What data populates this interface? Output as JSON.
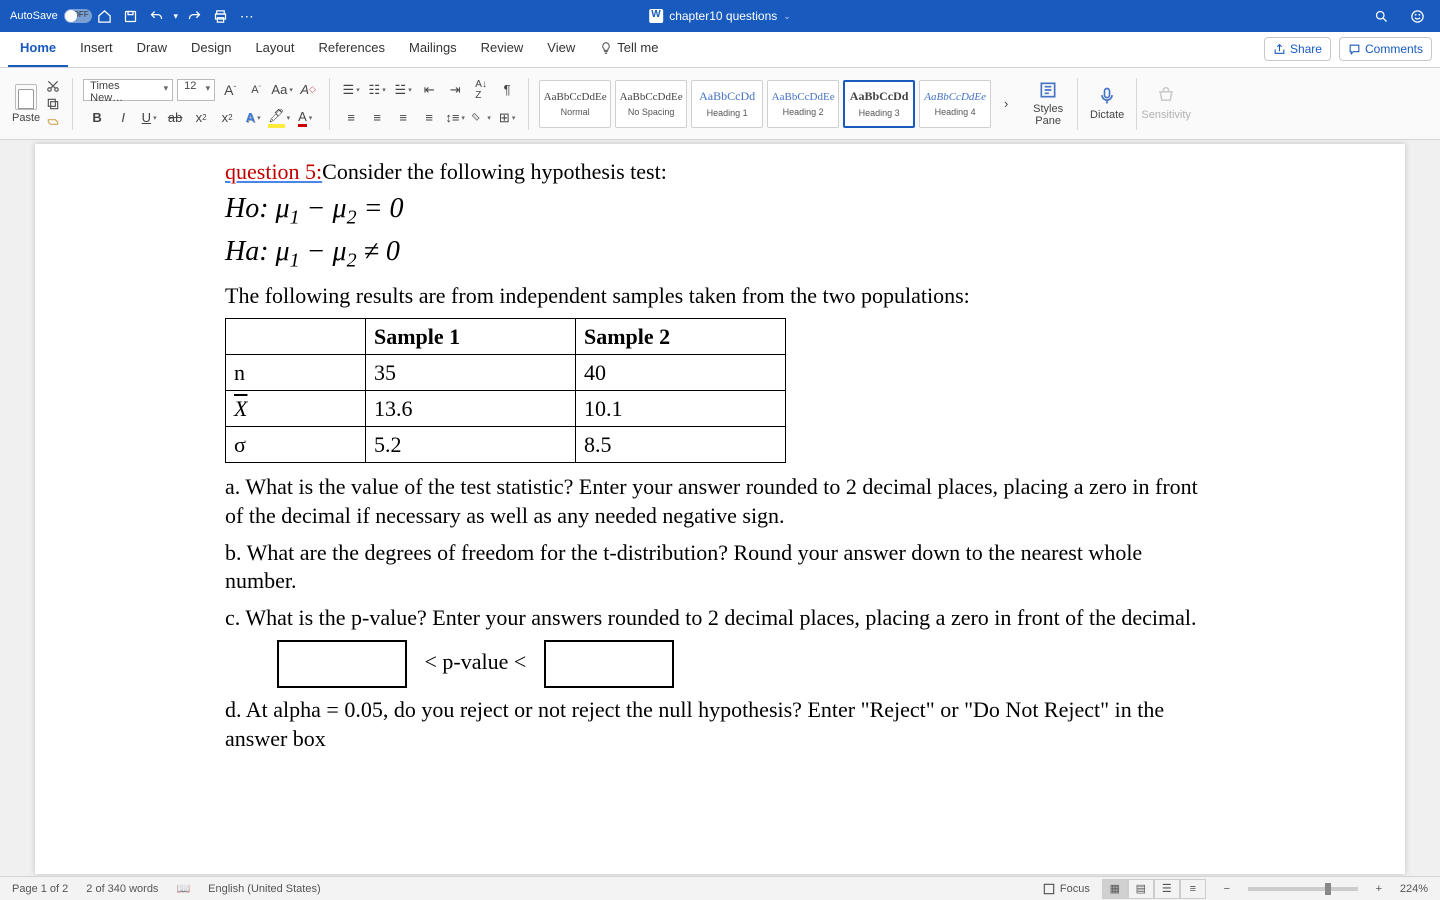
{
  "titlebar": {
    "autosave_label": "AutoSave",
    "autosave_state": "OFF",
    "doc_title": "chapter10 questions"
  },
  "tabs": [
    "Home",
    "Insert",
    "Draw",
    "Design",
    "Layout",
    "References",
    "Mailings",
    "Review",
    "View"
  ],
  "tellme": "Tell me",
  "share": "Share",
  "comments": "Comments",
  "ribbon": {
    "paste": "Paste",
    "font_name": "Times New…",
    "font_size": "12",
    "styles": [
      {
        "preview": "AaBbCcDdEe",
        "label": "Normal"
      },
      {
        "preview": "AaBbCcDdEe",
        "label": "No Spacing"
      },
      {
        "preview": "AaBbCcDd",
        "label": "Heading 1"
      },
      {
        "preview": "AaBbCcDdEe",
        "label": "Heading 2"
      },
      {
        "preview": "AaBbCcDd",
        "label": "Heading 3"
      },
      {
        "preview": "AaBbCcDdEe",
        "label": "Heading 4"
      }
    ],
    "styles_pane": "Styles Pane",
    "dictate": "Dictate",
    "sensitivity": "Sensitivity"
  },
  "document": {
    "qnum": "question 5:",
    "qtext": "Consider the following hypothesis test:",
    "ho": "Ho: μ",
    "ho_rest": " − μ",
    "ho_eq": " = 0",
    "ha": "Ha: μ",
    "ha_rest": " − μ",
    "ha_eq": " ≠ 0",
    "followup": "The following results are from independent samples taken from the two populations:",
    "table": {
      "h1": "Sample 1",
      "h2": "Sample 2",
      "r1c0": "n",
      "r1c1": "35",
      "r1c2": "40",
      "r2c0": "X",
      "r2c1": "13.6",
      "r2c2": "10.1",
      "r3c0": "σ",
      "r3c1": "5.2",
      "r3c2": "8.5"
    },
    "pa": "a. What is the value of the test statistic? Enter your answer rounded to 2 decimal places, placing a zero in front of the decimal if necessary as well as any needed negative sign.",
    "pb": "b. What are the degrees of freedom for the t-distribution? Round your answer down to the nearest whole number.",
    "pc": "c. What is the p-value? Enter your answers rounded to 2 decimal places, placing a zero in front of the decimal.",
    "pvalue_label": "< p-value <",
    "pd": "d. At alpha = 0.05, do you reject or not reject the null hypothesis? Enter \"Reject\" or \"Do Not Reject\" in the answer box"
  },
  "status": {
    "page": "Page 1 of 2",
    "words": "2 of 340 words",
    "lang": "English (United States)",
    "focus": "Focus",
    "zoom": "224%"
  }
}
